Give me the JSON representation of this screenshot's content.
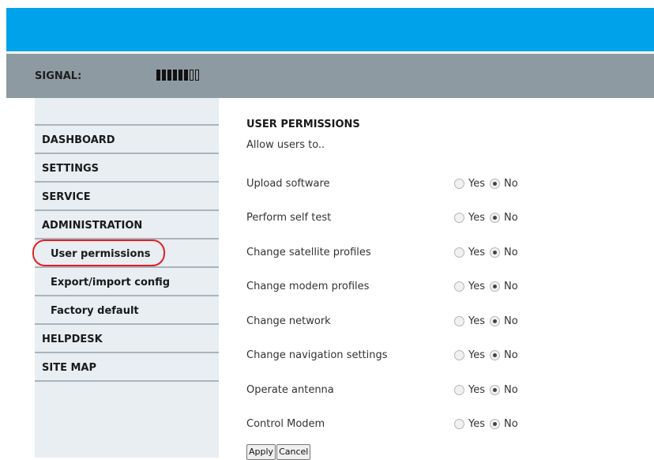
{
  "header": {
    "signal_label": "SIGNAL:",
    "signal_level": {
      "filled": 6,
      "total": 8
    }
  },
  "sidebar": {
    "items": [
      {
        "label": "DASHBOARD"
      },
      {
        "label": "SETTINGS"
      },
      {
        "label": "SERVICE"
      },
      {
        "label": "ADMINISTRATION"
      },
      {
        "label": "User permissions"
      },
      {
        "label": "Export/import config"
      },
      {
        "label": "Factory default"
      },
      {
        "label": "HELPDESK"
      },
      {
        "label": "SITE MAP"
      }
    ]
  },
  "main": {
    "title": "USER PERMISSIONS",
    "intro": "Allow users to..",
    "yes_label": "Yes",
    "no_label": "No",
    "permissions": [
      {
        "label": "Upload software",
        "selected": "No"
      },
      {
        "label": "Perform self test",
        "selected": "No"
      },
      {
        "label": "Change satellite profiles",
        "selected": "No"
      },
      {
        "label": "Change modem profiles",
        "selected": "No"
      },
      {
        "label": "Change network",
        "selected": "No"
      },
      {
        "label": "Change navigation settings",
        "selected": "No"
      },
      {
        "label": "Operate antenna",
        "selected": "No"
      },
      {
        "label": "Control Modem",
        "selected": "No"
      }
    ],
    "apply_label": "Apply",
    "cancel_label": "Cancel"
  },
  "colors": {
    "header_blue": "#00a2ea",
    "signal_bar_gray": "#8e9aa2",
    "sidebar_bg": "#e8eef2",
    "highlight_red": "#e31f26"
  }
}
